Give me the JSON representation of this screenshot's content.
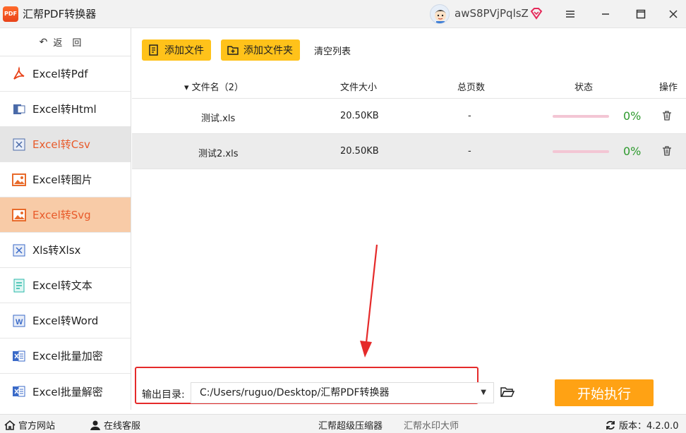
{
  "window": {
    "app_logo_text": "PDF",
    "title": "汇帮PDF转换器",
    "user_name": "awS8PVjPqlsZ"
  },
  "sidebar": {
    "back_label": "返回",
    "items": [
      {
        "label": "Excel转Pdf",
        "icon": "pdf-icon",
        "color": "#e8431a"
      },
      {
        "label": "Excel转Html",
        "icon": "html-icon",
        "color": "#4a6aa8"
      },
      {
        "label": "Excel转Csv",
        "icon": "csv-icon",
        "color": "#4a6aa8"
      },
      {
        "label": "Excel转图片",
        "icon": "image-icon",
        "color": "#e86a2a"
      },
      {
        "label": "Excel转Svg",
        "icon": "svg-image-icon",
        "color": "#e86a2a"
      },
      {
        "label": "Xls转Xlsx",
        "icon": "xlsx-icon",
        "color": "#3a6ac8"
      },
      {
        "label": "Excel转文本",
        "icon": "text-doc-icon",
        "color": "#2ab8a8"
      },
      {
        "label": "Excel转Word",
        "icon": "word-icon",
        "color": "#3a6ac8"
      },
      {
        "label": "Excel批量加密",
        "icon": "encrypt-excel-icon",
        "color": "#3a6ac8"
      },
      {
        "label": "Excel批量解密",
        "icon": "decrypt-excel-icon",
        "color": "#3a6ac8"
      }
    ]
  },
  "toolbar": {
    "add_file_label": "添加文件",
    "add_folder_label": "添加文件夹",
    "clear_list_label": "清空列表"
  },
  "table": {
    "columns": {
      "filename": "文件名（2）",
      "size": "文件大小",
      "pages": "总页数",
      "status": "状态",
      "action": "操作"
    },
    "rows": [
      {
        "name": "测试.xls",
        "size": "20.50KB",
        "pages": "-",
        "progress": "0%"
      },
      {
        "name": "测试2.xls",
        "size": "20.50KB",
        "pages": "-",
        "progress": "0%"
      }
    ]
  },
  "output": {
    "label": "输出目录:",
    "path": "C:/Users/ruguo/Desktop/汇帮PDF转换器",
    "start_label": "开始执行"
  },
  "statusbar": {
    "website": "官方网站",
    "support": "在线客服",
    "product1": "汇帮超级压缩器",
    "product2": "汇帮水印大师",
    "version": "版本：4.2.0.0"
  },
  "colors": {
    "accent": "#ffc21a",
    "start_button": "#ffa214",
    "active_item_bg": "#f8cba7",
    "active_item_text": "#e85a2a",
    "progress_text": "#2e9a2e",
    "highlight_box": "#e52a2a"
  }
}
